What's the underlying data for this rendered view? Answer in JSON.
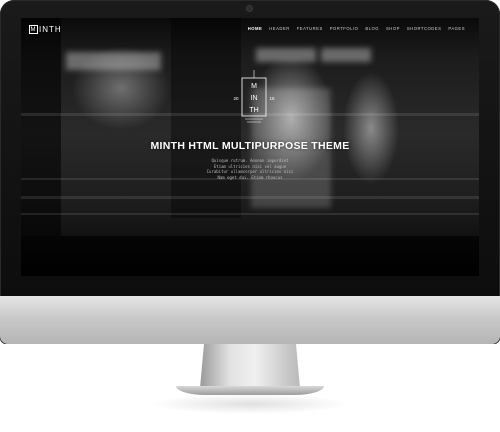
{
  "site": {
    "logo_letter": "M",
    "logo_text": "INTH",
    "nav": [
      {
        "label": "HOME",
        "active": true
      },
      {
        "label": "HEADER",
        "active": false
      },
      {
        "label": "FEATURES",
        "active": false
      },
      {
        "label": "PORTFOLIO",
        "active": false
      },
      {
        "label": "BLOG",
        "active": false
      },
      {
        "label": "SHOP",
        "active": false
      },
      {
        "label": "SHORTCODES",
        "active": false
      },
      {
        "label": "PAGES",
        "active": false
      }
    ]
  },
  "emblem": {
    "letters": [
      "M",
      "IN",
      "TH"
    ],
    "year_left": "20",
    "year_right": "15"
  },
  "hero": {
    "title": "MINTH HTML MULTIPURPOSE THEME",
    "subtitle_lines": [
      "Quisque rutrum. Aenean imperdiet",
      "Etiam ultricies nisi vel augue",
      "Curabitur ullamcorper ultricies nisi",
      "Nam eget dui. Etiam rhoncus"
    ]
  }
}
